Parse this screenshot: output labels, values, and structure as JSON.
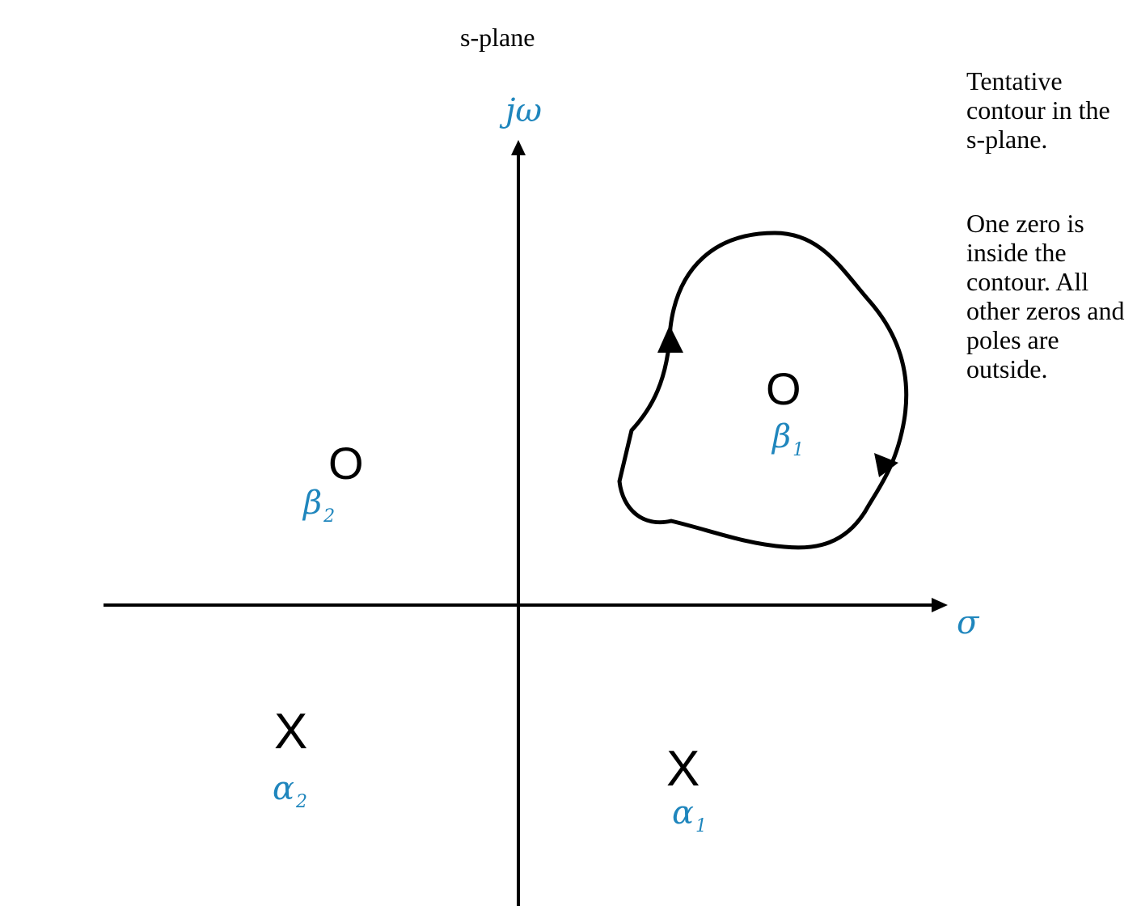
{
  "title": "s-plane",
  "axes": {
    "vertical_label": "jω",
    "horizontal_label": "σ"
  },
  "notes": {
    "contour": "Tentative contour in the s-plane.",
    "zeros": "One zero is inside the contour. All other zeros and poles are outside."
  },
  "zeros": [
    {
      "marker": "O",
      "symbol": "β",
      "subscript": "1"
    },
    {
      "marker": "O",
      "symbol": "β",
      "subscript": "2"
    }
  ],
  "poles": [
    {
      "marker": "X",
      "symbol": "α",
      "subscript": "1"
    },
    {
      "marker": "X",
      "symbol": "α",
      "subscript": "2"
    }
  ],
  "colors": {
    "label": "#1f86bd",
    "line": "#000000"
  }
}
